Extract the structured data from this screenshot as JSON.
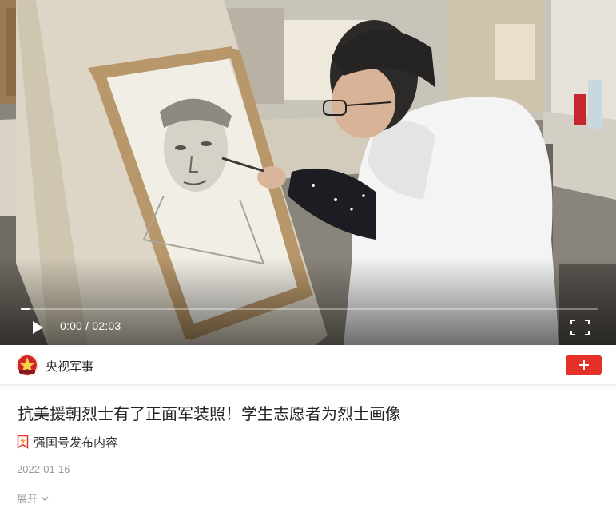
{
  "video": {
    "current_time": "0:00",
    "duration": "02:03",
    "time_separator": " / ",
    "progress_fraction": 0.015,
    "icons": {
      "play": "play-icon",
      "fullscreen": "fullscreen-icon"
    }
  },
  "channel": {
    "name": "央视军事",
    "avatar_icon": "cctv-military-logo",
    "follow_icon": "plus-icon",
    "accent": "#e5312a"
  },
  "article": {
    "title": "抗美援朝烈士有了正面军装照！学生志愿者为烈士画像",
    "source_label": "强国号发布内容",
    "source_icon": "badge-icon",
    "date": "2022-01-16",
    "expand_label": "展开",
    "expand_icon": "chevron-down-icon"
  }
}
